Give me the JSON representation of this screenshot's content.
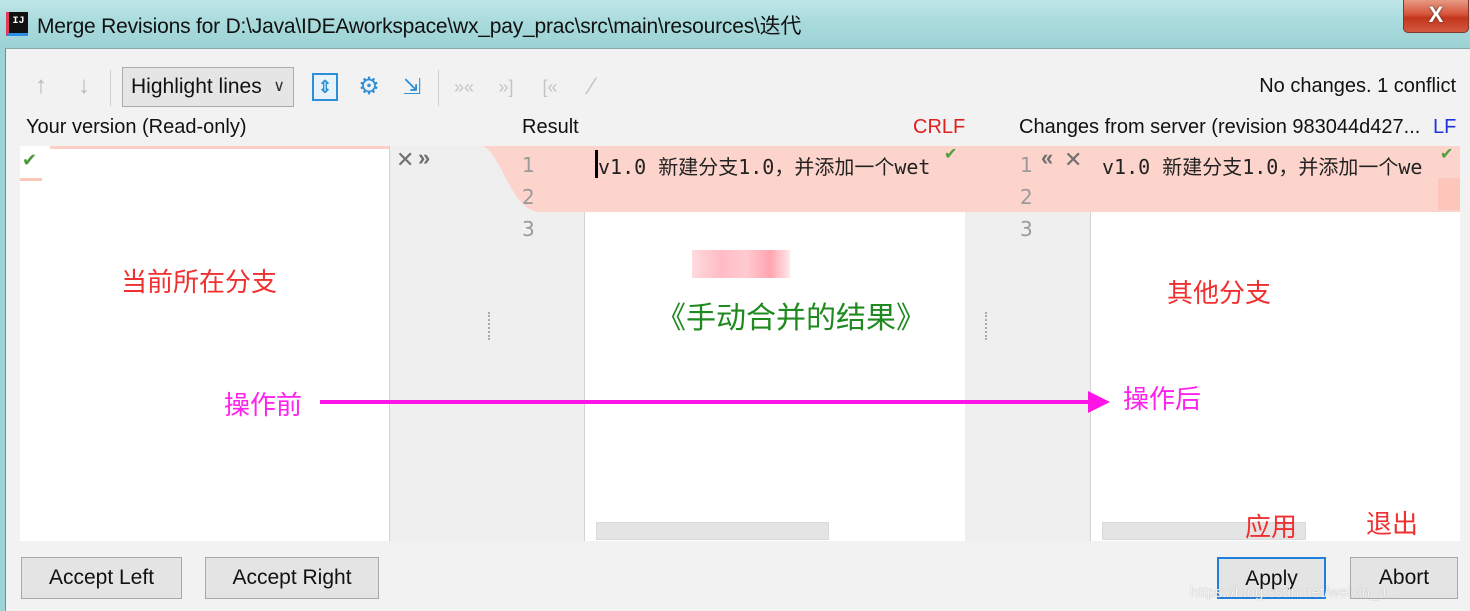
{
  "window": {
    "title": "Merge Revisions for D:\\Java\\IDEAworkspace\\wx_pay_prac\\src\\main\\resources\\迭代",
    "app_icon": "intellij-icon",
    "close_label": "X"
  },
  "toolbar": {
    "prev_icon": "↑",
    "next_icon": "↓",
    "highlight_mode": "Highlight lines",
    "chevron": "∨",
    "icons": {
      "sync_scroll": "⇕",
      "settings": "⚙",
      "collapse": "⇲",
      "apply_non_conflict": "»«",
      "apply_left": "»]",
      "apply_right": "[«",
      "magic_resolve": "⁄"
    },
    "status": "No changes. 1 conflict"
  },
  "panes": {
    "left": {
      "title": "Your version (Read-only)"
    },
    "center": {
      "title": "Result",
      "line_ending": "CRLF"
    },
    "right": {
      "title": "Changes from server (revision 983044d427...",
      "line_ending": "LF"
    }
  },
  "gutter_left": {
    "line_numbers": [
      "1",
      "2",
      "3"
    ],
    "reject_icon": "✕",
    "accept_icon": "»"
  },
  "gutter_right": {
    "line_numbers": [
      "1",
      "2",
      "3"
    ],
    "accept_icon": "«",
    "reject_icon": "✕"
  },
  "content": {
    "center_line1": "v1.0  新建分支1.0，并添加一个wet",
    "right_line1": "v1.0  新建分支1.0，并添加一个we",
    "check": "✔"
  },
  "annotations": {
    "current_branch": "当前所在分支",
    "manual_merge_result": "《手动合并的结果》",
    "other_branch": "其他分支",
    "before_op": "操作前",
    "after_op": "操作后",
    "apply_cn": "应用",
    "exit_cn": "退出"
  },
  "buttons": {
    "accept_left": "Accept Left",
    "accept_right": "Accept Right",
    "apply": "Apply",
    "abort": "Abort"
  },
  "watermark": "https://blog.csdn.net/weixin_4..."
}
